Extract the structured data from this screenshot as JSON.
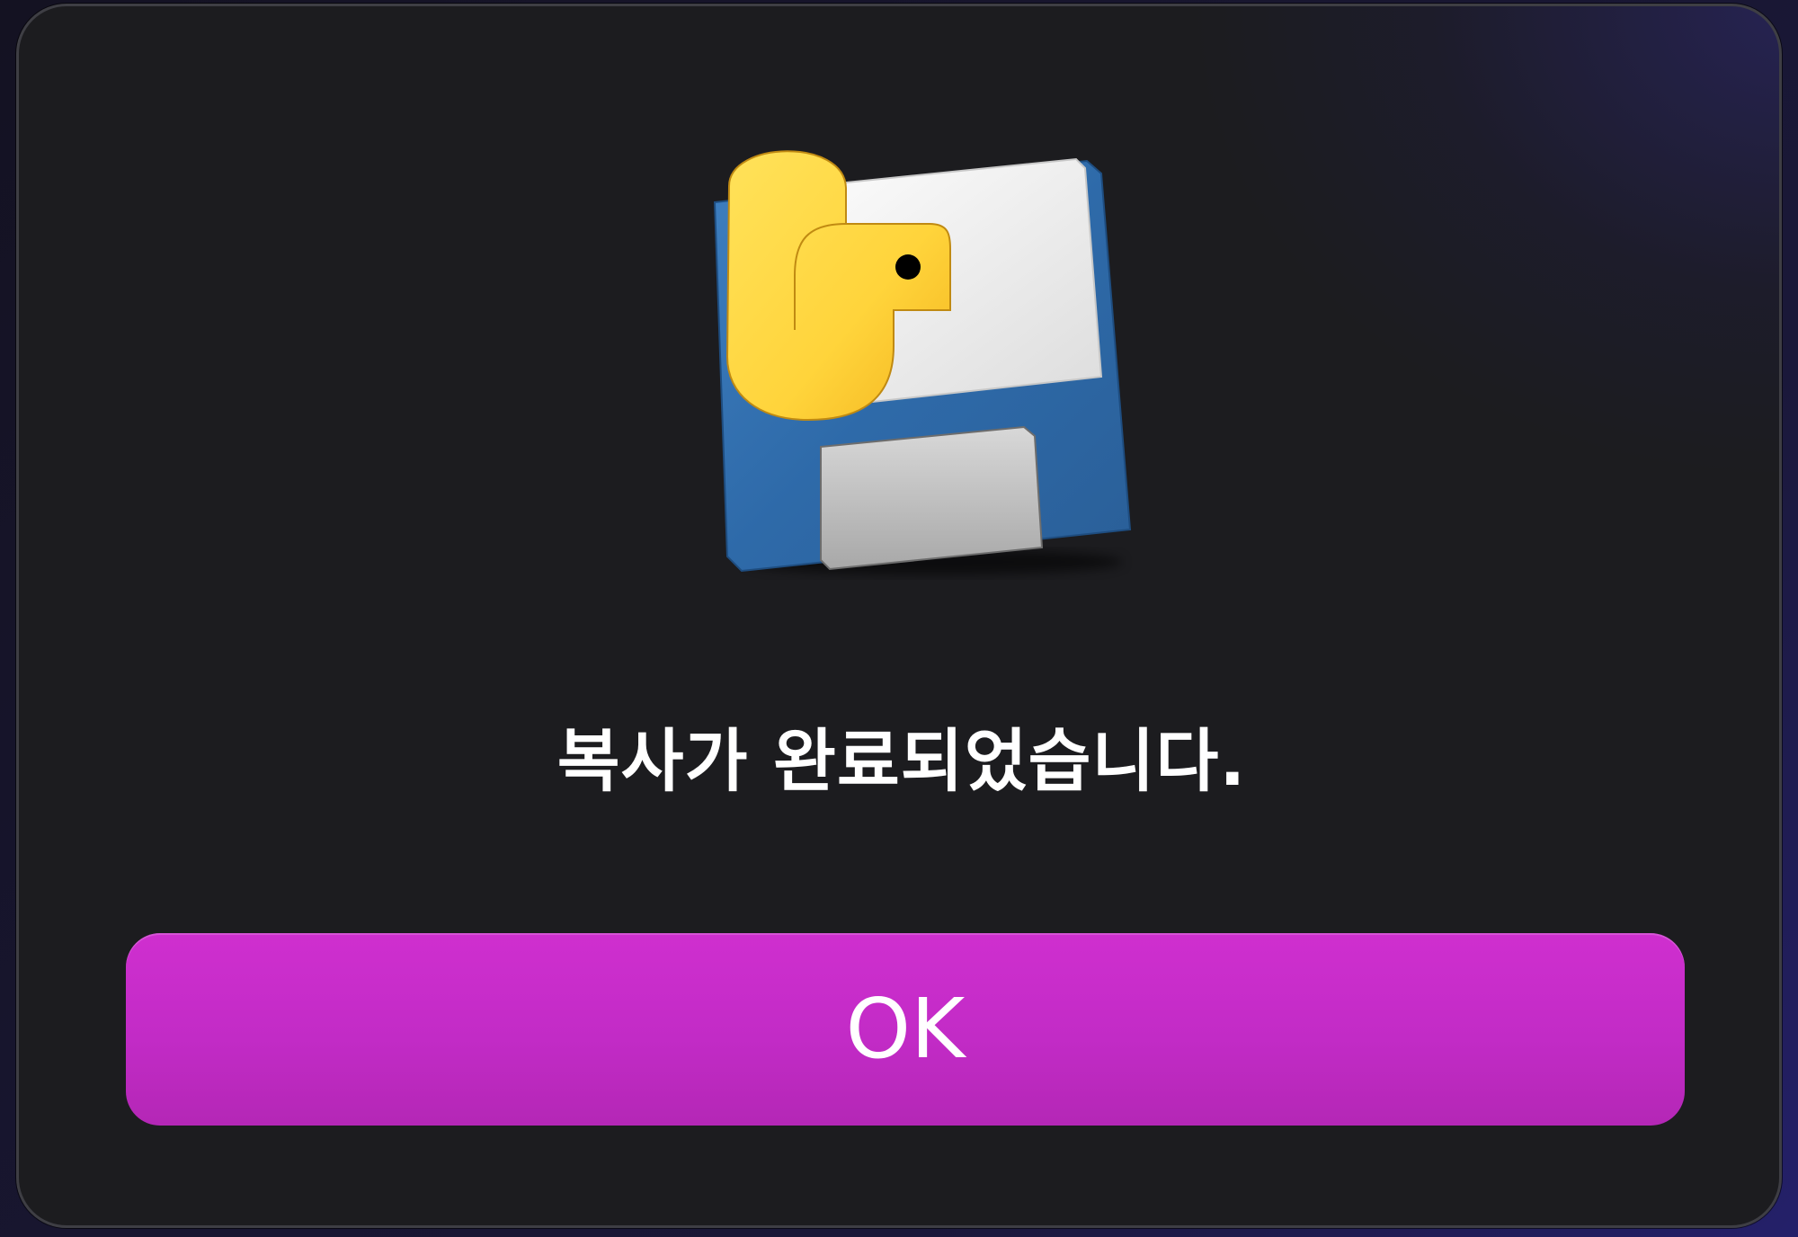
{
  "dialog": {
    "icon": "python-floppy-disk-icon",
    "message": "복사가 완료되었습니다.",
    "ok_label": "OK"
  },
  "colors": {
    "dialog_background": "#1c1c1f",
    "button_accent": "#c22bc6",
    "text": "#ffffff"
  }
}
